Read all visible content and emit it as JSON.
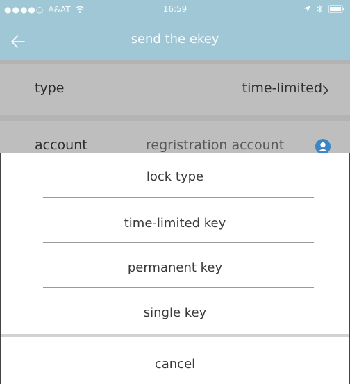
{
  "status_bar": {
    "signal": "●●●●○",
    "carrier": "A&AT",
    "time": "16:59"
  },
  "nav": {
    "title": "send the ekey",
    "back_icon": "back-arrow-icon"
  },
  "form": {
    "type_label": "type",
    "type_value": "time-limited",
    "account_label": "account",
    "account_placeholder": "regristration account",
    "contact_icon": "contact-icon"
  },
  "sheet": {
    "title": "lock type",
    "options": [
      "time-limited key",
      "permanent key",
      "single key"
    ],
    "cancel_label": "cancel"
  },
  "colors": {
    "header": "#9fc7d6",
    "row": "#bebebe",
    "sheet": "#ffffff",
    "divider": "#9a9a9a",
    "contact_icon": "#3d86c6"
  }
}
